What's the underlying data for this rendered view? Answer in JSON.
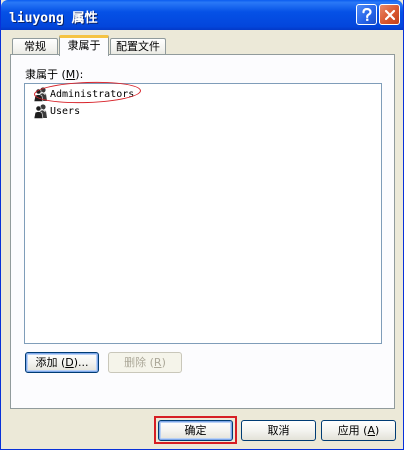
{
  "window": {
    "title": "liuyong 属性"
  },
  "tabs": [
    {
      "label": "常规"
    },
    {
      "label": "隶属于",
      "active": true
    },
    {
      "label": "配置文件"
    }
  ],
  "member_of": {
    "label_text": "隶属于 (",
    "label_key": "M",
    "label_end": "):",
    "items": [
      {
        "name": "Administrators",
        "icon": "group-icon"
      },
      {
        "name": "Users",
        "icon": "group-icon"
      }
    ]
  },
  "buttons": {
    "add_text": "添加 (",
    "add_key": "D",
    "add_end": ")...",
    "remove_text": "删除 (",
    "remove_key": "R",
    "remove_end": ")",
    "ok": "确定",
    "cancel": "取消",
    "apply_text": "应用 (",
    "apply_key": "A",
    "apply_end": ")"
  },
  "colors": {
    "title_bar": "#0551e6",
    "annotation_red": "#d61e24",
    "tab_highlight": "#f5c343"
  }
}
